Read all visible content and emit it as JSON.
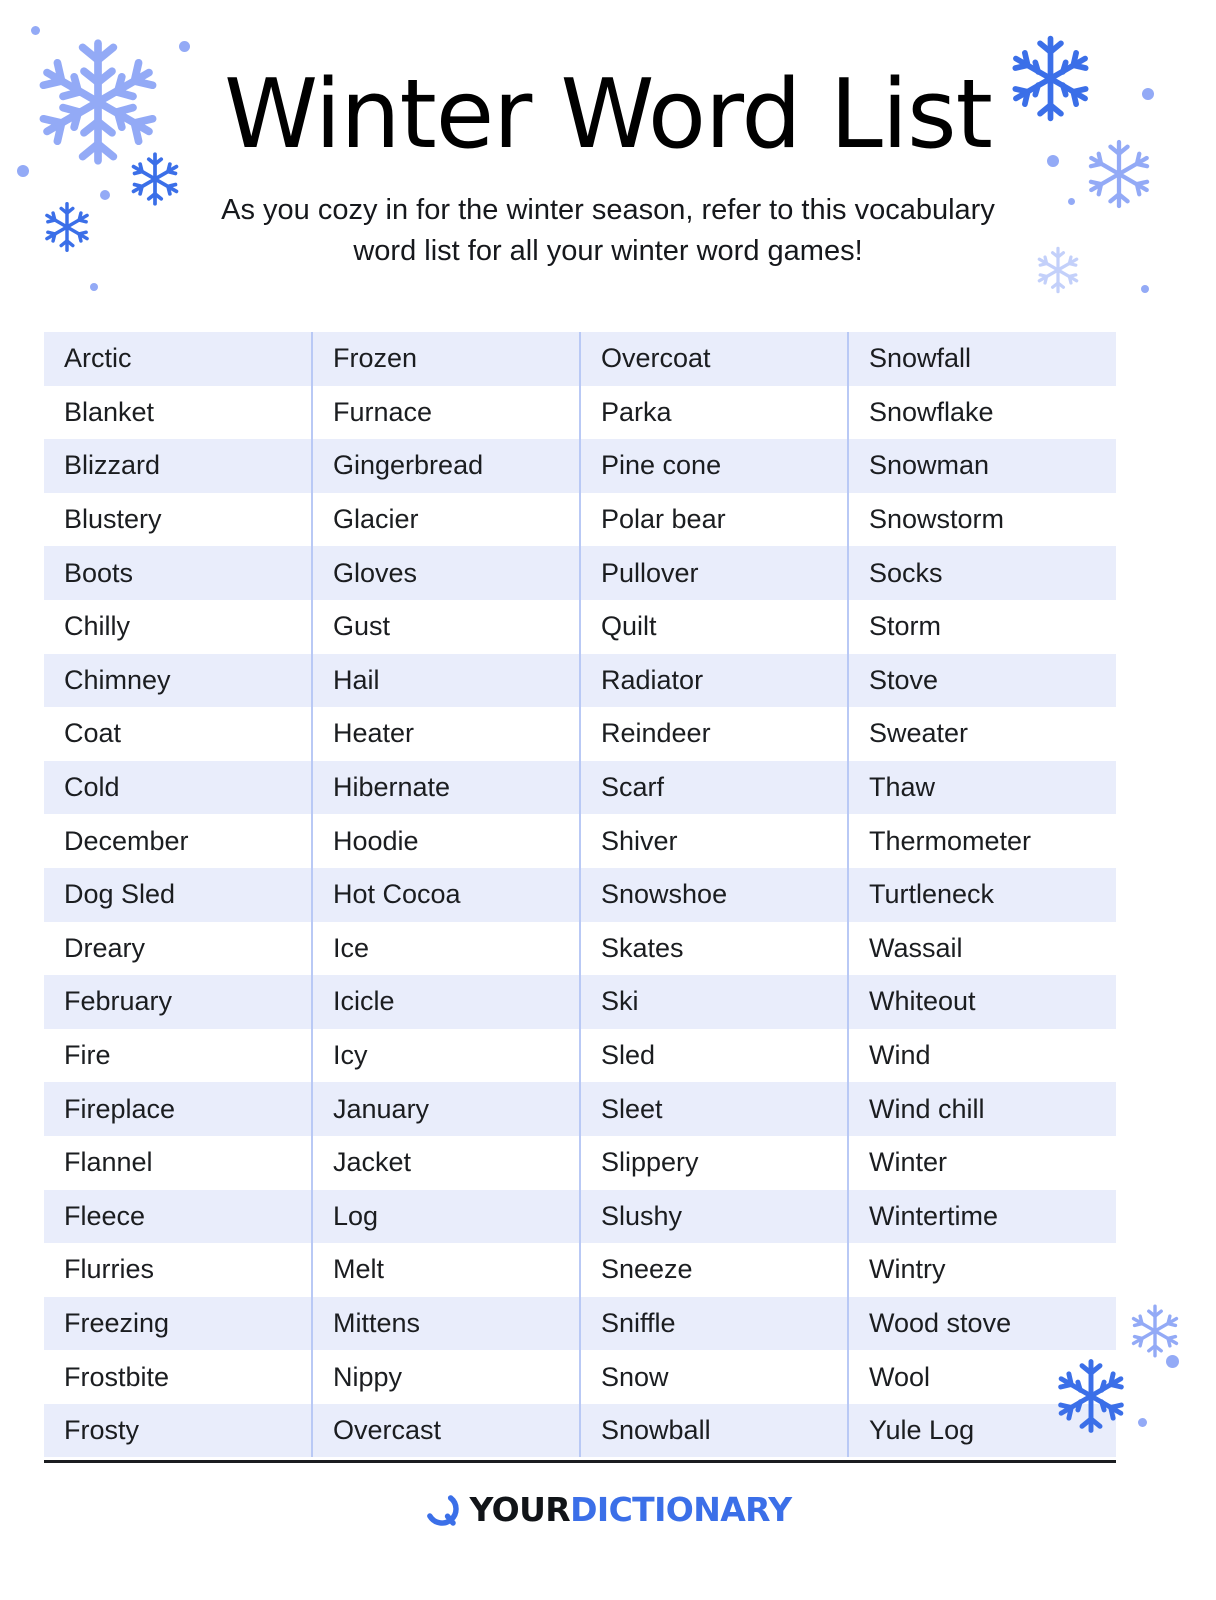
{
  "header": {
    "title": "Winter Word List",
    "subtitle_line1": "As you cozy in for the winter season, refer to this vocabulary",
    "subtitle_line2": "word list for all your winter word games!"
  },
  "colors": {
    "stripe": "#e9edfb",
    "divider": "#b9c9f5",
    "rule": "#1b1d20",
    "snowflake_light": "#93aaf6",
    "snowflake_dark": "#3b6fe8",
    "brand_blue": "#3b6fe8",
    "text": "#1b1d20",
    "background": "#ffffff"
  },
  "table": {
    "columns": 4,
    "rows": 22,
    "column1": [
      "Arctic",
      "Blanket",
      "Blizzard",
      "Blustery",
      "Boots",
      "Chilly",
      "Chimney",
      "Coat",
      "Cold",
      "December",
      "Dog Sled",
      "Dreary",
      "February",
      "Fire",
      "Fireplace",
      "Flannel",
      "Fleece",
      "Flurries",
      "Freezing",
      "Frostbite",
      "Frosty"
    ],
    "column2": [
      "Frozen",
      "Furnace",
      "Gingerbread",
      "Glacier",
      "Gloves",
      "Gust",
      "Hail",
      "Heater",
      "Hibernate",
      "Hoodie",
      "Hot Cocoa",
      "Ice",
      "Icicle",
      "Icy",
      "January",
      "Jacket",
      "Log",
      "Melt",
      "Mittens",
      "Nippy",
      "Overcast"
    ],
    "column3": [
      "Overcoat",
      "Parka",
      "Pine cone",
      "Polar bear",
      "Pullover",
      "Quilt",
      "Radiator",
      "Reindeer",
      "Scarf",
      "Shiver",
      "Snowshoe",
      "Skates",
      "Ski",
      "Sled",
      "Sleet",
      "Slippery",
      "Slushy",
      "Sneeze",
      "Sniffle",
      "Snow",
      "Snowball"
    ],
    "column4": [
      "Snowfall",
      "Snowflake",
      "Snowman",
      "Snowstorm",
      "Socks",
      "Storm",
      "Stove",
      "Sweater",
      "Thaw",
      "Thermometer",
      "Turtleneck",
      "Wassail",
      "Whiteout",
      "Wind",
      "Wind chill",
      "Winter",
      "Wintertime",
      "Wintry",
      "Wood stove",
      "Wool",
      "Yule Log"
    ]
  },
  "footer": {
    "logo_text_primary": "YOUR",
    "logo_text_secondary": "DICTIONARY",
    "logo_mark": "q-circle-icon"
  },
  "decorations": {
    "snowflake_count": 9,
    "dot_count": 11
  }
}
